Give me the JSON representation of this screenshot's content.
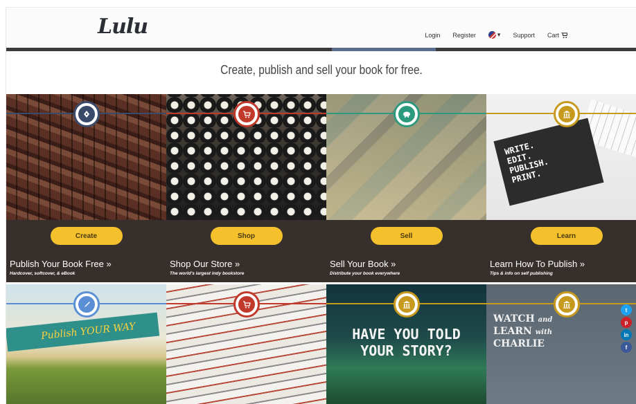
{
  "header": {
    "logo": "Lulu",
    "nav": {
      "login": "Login",
      "register": "Register",
      "language": "▾",
      "support": "Support",
      "cart": "Cart"
    }
  },
  "tagline": "Create, publish and sell your book for free.",
  "tiles_top": [
    {
      "button": "Create",
      "title": "Publish Your Book Free »",
      "subtitle": "Hardcover, softcover, & eBook",
      "accent": "#3a4a6b",
      "icon": "pen-nib-icon"
    },
    {
      "button": "Shop",
      "title": "Shop Our Store »",
      "subtitle": "The world's largest indy bookstore",
      "accent": "#c0392b",
      "icon": "cart-icon"
    },
    {
      "button": "Sell",
      "title": "Sell Your Book »",
      "subtitle": "Distribute your book everywhere",
      "accent": "#2c9a7e",
      "icon": "piggy-bank-icon"
    },
    {
      "button": "Learn",
      "title": "Learn How To Publish »",
      "subtitle": "Tips & info on self publishing",
      "accent": "#c79a1e",
      "icon": "institution-icon"
    }
  ],
  "learn_book": {
    "line1": "WRITE.",
    "line2": "EDIT.",
    "line3": "PUBLISH.",
    "line4": "PRINT."
  },
  "tiles_bottom": [
    {
      "accent": "#5a8fd6",
      "icon": "rocket-icon",
      "ribbon": "Publish YOUR WAY"
    },
    {
      "accent": "#c0392b",
      "icon": "cart-icon"
    },
    {
      "accent": "#c79a1e",
      "icon": "institution-icon",
      "text_line1": "HAVE YOU TOLD",
      "text_line2": "YOUR STORY?"
    },
    {
      "accent": "#c79a1e",
      "icon": "institution-icon",
      "text_line1": "WATCH",
      "text_line1b": "and",
      "text_line2": "LEARN",
      "text_line2b": "with",
      "text_line3": "CHARLIE"
    }
  ],
  "colors": {
    "button_yellow": "#f4c12c",
    "dark_band": "#372f2b",
    "header_bar": "#3b3b3b"
  },
  "social": [
    "twitter-icon",
    "pinterest-icon",
    "linkedin-icon",
    "facebook-icon"
  ]
}
